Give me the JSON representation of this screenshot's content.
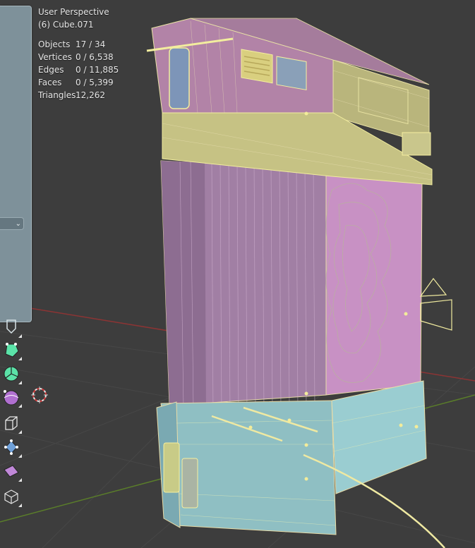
{
  "viewport": {
    "view_name": "User Perspective",
    "active_object": "(6) Cube.071"
  },
  "stats": [
    {
      "label": "Objects",
      "value": "17 / 34"
    },
    {
      "label": "Vertices",
      "value": "0 / 6,538"
    },
    {
      "label": "Edges",
      "value": "0 / 11,885"
    },
    {
      "label": "Faces",
      "value": "0 / 5,399"
    },
    {
      "label": "Triangles",
      "value": "12,262"
    }
  ],
  "panel": {
    "dropdown_icon": "chevron-down-icon"
  },
  "toolbar": {
    "tools": [
      {
        "name": "select-tool-icon"
      },
      {
        "name": "move-tool-icon"
      },
      {
        "name": "rotate-tool-icon"
      },
      {
        "name": "scale-tool-icon"
      },
      {
        "name": "cursor-tool-icon"
      },
      {
        "name": "extrude-tool-icon"
      },
      {
        "name": "transform-tool-icon"
      },
      {
        "name": "shear-tool-icon"
      },
      {
        "name": "add-cube-tool-icon"
      }
    ]
  },
  "colors": {
    "background": "#3d3d3d",
    "grid_x_axis": "#b03a3a",
    "grid_y_axis": "#6e9a2e",
    "object_pink": "#c98ab8",
    "object_yellow": "#c9c78d",
    "object_cyan": "#8fc6cc",
    "selection_outline": "#f0ec9a",
    "tool_accent": "#5be3a8"
  }
}
